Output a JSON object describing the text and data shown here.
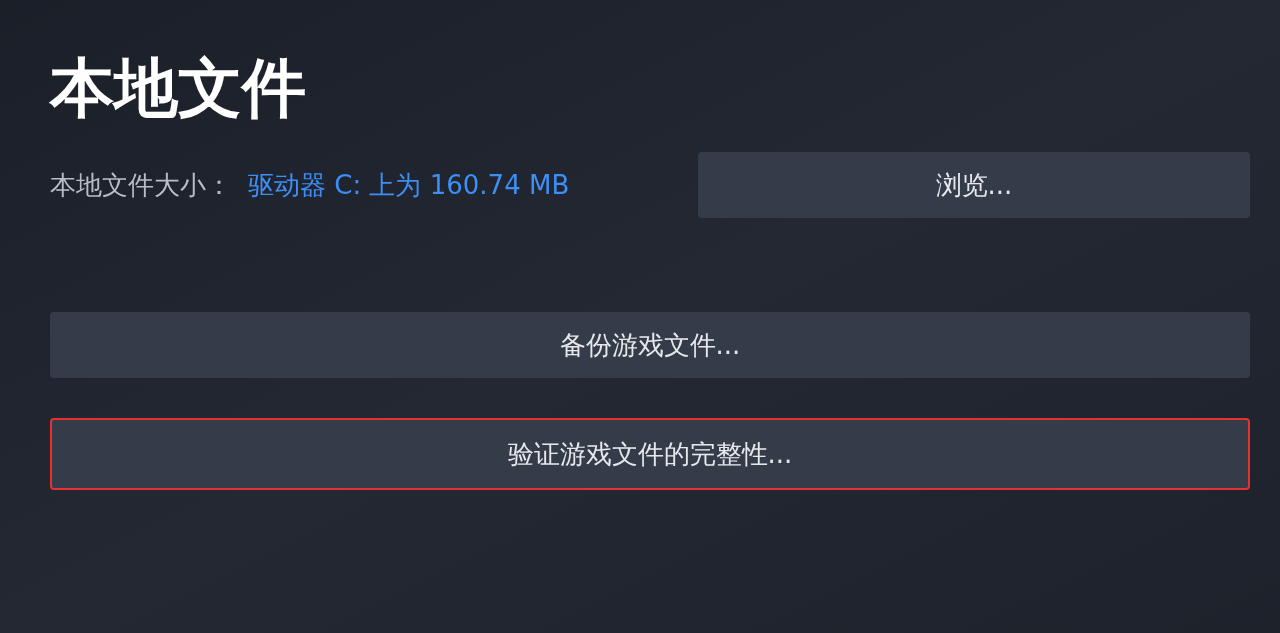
{
  "title": "本地文件",
  "size_label": "本地文件大小：",
  "size_value": "驱动器 C: 上为 160.74 MB",
  "browse_button": {
    "label": "浏览...",
    "highlighted": false
  },
  "buttons": [
    {
      "label": "备份游戏文件...",
      "highlighted": false
    },
    {
      "label": "验证游戏文件的完整性...",
      "highlighted": true
    }
  ]
}
